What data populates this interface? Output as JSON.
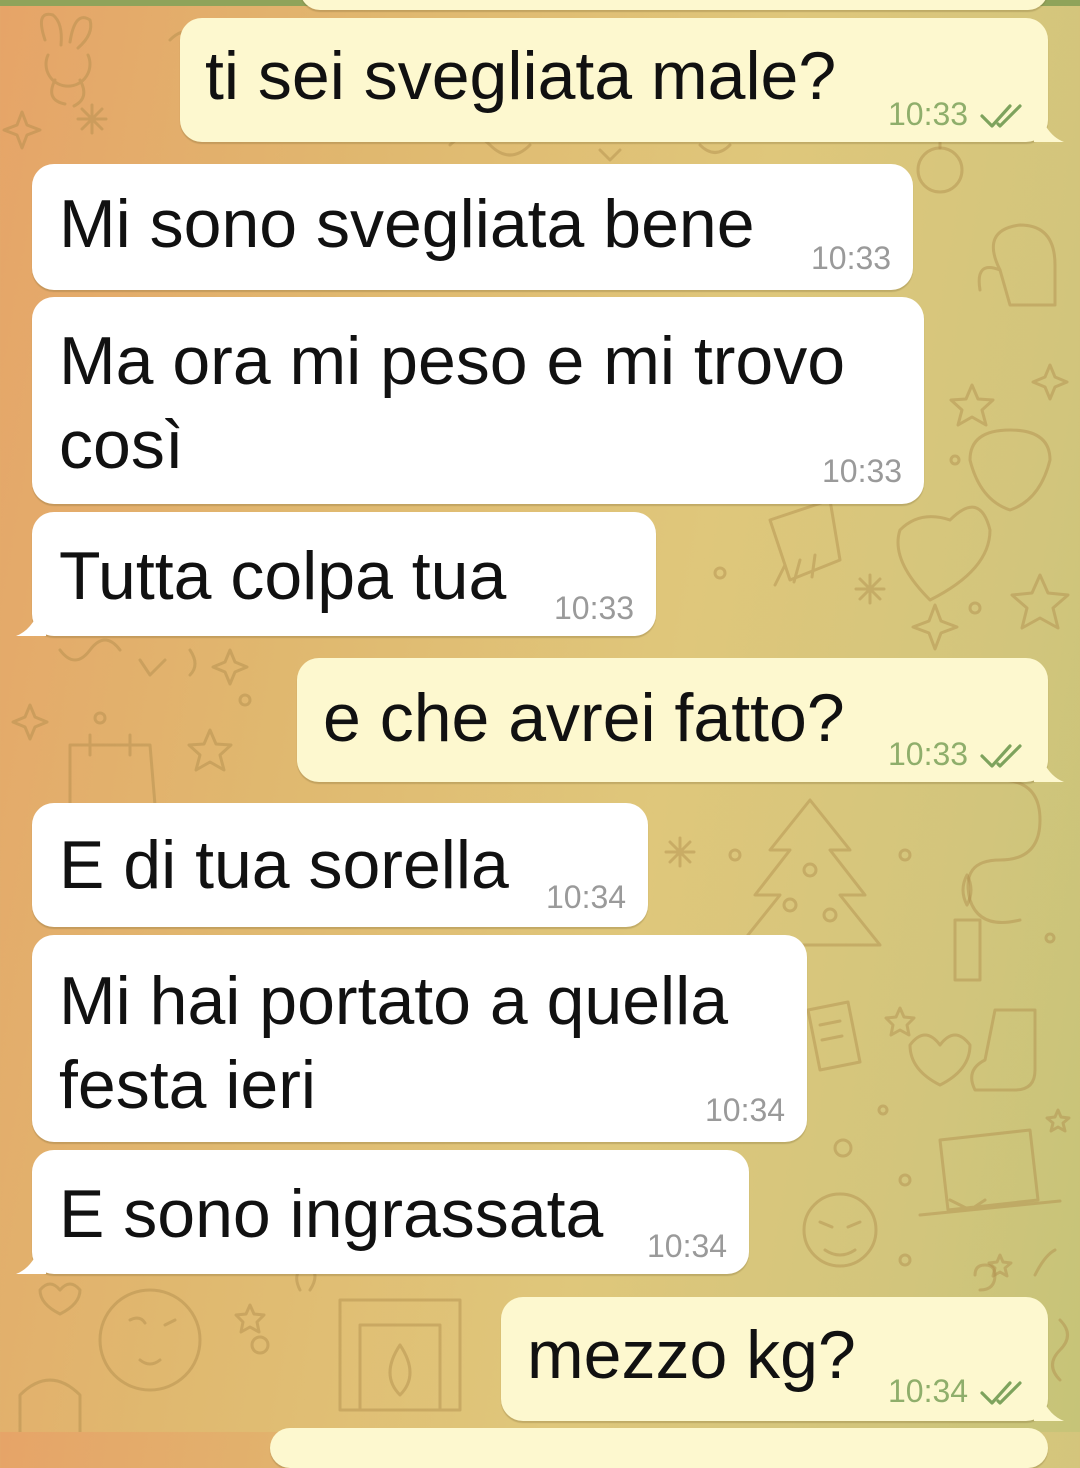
{
  "chat": {
    "messages": [
      {
        "direction": "out",
        "text": "ti sei svegliata male?",
        "time": "10:33",
        "status": "read-double-check-icon"
      },
      {
        "direction": "in",
        "text": "Mi sono svegliata bene",
        "time": "10:33"
      },
      {
        "direction": "in",
        "text": "Ma ora mi peso e mi trovo\ncosì",
        "time": "10:33"
      },
      {
        "direction": "in",
        "text": "Tutta colpa tua",
        "time": "10:33"
      },
      {
        "direction": "out",
        "text": "e che avrei fatto?",
        "time": "10:33",
        "status": "read-double-check-icon"
      },
      {
        "direction": "in",
        "text": "E di tua sorella",
        "time": "10:34"
      },
      {
        "direction": "in",
        "text": "Mi hai portato a quella\nfesta ieri",
        "time": "10:34"
      },
      {
        "direction": "in",
        "text": "E sono ingrassata",
        "time": "10:34"
      },
      {
        "direction": "out",
        "text": "mezzo kg?",
        "time": "10:34",
        "status": "read-double-check-icon"
      }
    ]
  },
  "colors": {
    "incoming_bubble": "#ffffff",
    "outgoing_bubble": "#fdf8cf",
    "outgoing_time": "#8fae6b",
    "read_ticks": "#7ea35d",
    "incoming_time": "#9a9a9a"
  }
}
